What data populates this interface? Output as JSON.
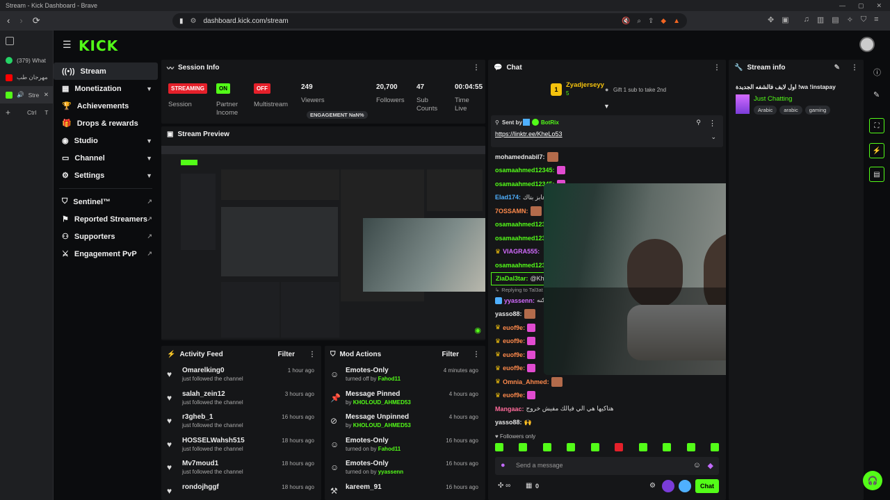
{
  "browser": {
    "title": "Stream - Kick Dashboard - Brave",
    "url": "dashboard.kick.com/stream",
    "tabs": [
      {
        "label": "(379) What"
      },
      {
        "label": "مهرجان طب"
      },
      {
        "label": "Stre"
      }
    ],
    "newtab_shortcut_ctrl": "Ctrl",
    "newtab_shortcut_key": "T"
  },
  "brand": {
    "logo": "KICK",
    "accent": "#53fc18"
  },
  "sidebar": {
    "items": [
      {
        "label": "Stream"
      },
      {
        "label": "Monetization"
      },
      {
        "label": "Achievements"
      },
      {
        "label": "Drops & rewards"
      },
      {
        "label": "Studio"
      },
      {
        "label": "Channel"
      },
      {
        "label": "Settings"
      }
    ],
    "extra": [
      {
        "label": "Sentinel™"
      },
      {
        "label": "Reported Streamers"
      },
      {
        "label": "Supporters"
      },
      {
        "label": "Engagement PvP"
      }
    ]
  },
  "session": {
    "title": "Session Info",
    "session_badge": "STREAMING",
    "session_label": "Session",
    "partner_badge": "ON",
    "partner_label1": "Partner",
    "partner_label2": "Income",
    "multi_badge": "OFF",
    "multi_label": "Multistream",
    "viewers": "249",
    "viewers_label": "Viewers",
    "engagement": "ENGAGEMENT NaN%",
    "followers": "20,700",
    "followers_label": "Followers",
    "subs": "47",
    "subs_label1": "Sub",
    "subs_label2": "Counts",
    "time": "00:04:55",
    "time_label1": "Time",
    "time_label2": "Live"
  },
  "preview": {
    "title": "Stream Preview"
  },
  "activity": {
    "title": "Activity Feed",
    "filter": "Filter",
    "rows": [
      {
        "name": "Omarelking0",
        "sub": "just followed the channel",
        "time": "1 hour ago"
      },
      {
        "name": "salah_zein12",
        "sub": "just followed the channel",
        "time": "3 hours ago"
      },
      {
        "name": "r3gheb_1",
        "sub": "just followed the channel",
        "time": "16 hours ago"
      },
      {
        "name": "HOSSELWahsh515",
        "sub": "just followed the channel",
        "time": "18 hours ago"
      },
      {
        "name": "Mv7moud1",
        "sub": "just followed the channel",
        "time": "18 hours ago"
      },
      {
        "name": "rondojhggf",
        "sub": "",
        "time": "18 hours ago"
      }
    ]
  },
  "mod": {
    "title": "Mod Actions",
    "filter": "Filter",
    "rows": [
      {
        "name": "Emotes-Only",
        "pre": "turned off by",
        "by": "Fahod11",
        "time": "4 minutes ago"
      },
      {
        "name": "Message Pinned",
        "pre": "by",
        "by": "KHOLOUD_AHMED53",
        "time": "4 hours ago"
      },
      {
        "name": "Message Unpinned",
        "pre": "by",
        "by": "KHOLOUD_AHMED53",
        "time": "4 hours ago"
      },
      {
        "name": "Emotes-Only",
        "pre": "turned on by",
        "by": "Fahod11",
        "time": "16 hours ago"
      },
      {
        "name": "Emotes-Only",
        "pre": "turned on by",
        "by": "yyassenn",
        "time": "16 hours ago"
      },
      {
        "name": "kareem_91",
        "pre": "",
        "by": "",
        "time": "16 hours ago"
      }
    ]
  },
  "chat": {
    "title": "Chat",
    "gifter": "Zyadjerseyy",
    "gifter_count": "5",
    "gift_text": "Gift 1 sub to take 2nd",
    "pinned_by_label": "Sent by",
    "pinned_by": "BotRix",
    "pinned_link": "https://linktr.ee/KheLo53",
    "lines": [
      {
        "user": "mohamednabil7:",
        "color": "#e6e6e6",
        "msg": ""
      },
      {
        "user": "osamaahmed12345:",
        "color": "#53fc18",
        "msg": ""
      },
      {
        "user": "osamaahmed12345:",
        "color": "#53fc18",
        "msg": ""
      },
      {
        "user": "Elad174:",
        "color": "#4fb0ff",
        "msg": "عد عابز بتاك"
      },
      {
        "user": "7OSSAMN:",
        "color": "#ff8a4c",
        "msg": ""
      },
      {
        "user": "osamaahmed1234",
        "color": "#53fc18",
        "msg": ""
      },
      {
        "user": "osamaahmed1234",
        "color": "#53fc18",
        "msg": ""
      },
      {
        "user": "VIAGRA555:",
        "color": "#d36bff",
        "msg": ""
      },
      {
        "user": "osamaahmed1234",
        "color": "#53fc18",
        "msg": ""
      }
    ],
    "reply_user": "ZiaDal3tar:",
    "reply_msg": "@Khek",
    "replying_label": "Replying to Tal3at",
    "reply_by": "yyassenn:",
    "reply_text": "ممكنه",
    "lines2": [
      {
        "user": "yasso88:",
        "color": "#e6e6e6",
        "msg": ""
      },
      {
        "user": "euof9e:",
        "color": "#ff8a4c",
        "msg": ""
      },
      {
        "user": "euof9e:",
        "color": "#ff8a4c",
        "msg": ""
      },
      {
        "user": "euof9e:",
        "color": "#ff8a4c",
        "msg": ""
      },
      {
        "user": "euof9e:",
        "color": "#ff8a4c",
        "msg": ""
      },
      {
        "user": "Omnia_Ahmed:",
        "color": "#ff8a4c",
        "msg": ""
      },
      {
        "user": "euof9e:",
        "color": "#ff8a4c",
        "msg": ""
      },
      {
        "user": "Mangaac:",
        "color": "#ff6b9a",
        "msg": "هتاكيها هي الي فيالك مفيش خروج"
      },
      {
        "user": "yasso88:",
        "color": "#e6e6e6",
        "msg": ""
      }
    ],
    "followers_only": "Followers only",
    "placeholder": "Send a message",
    "count_a": "0",
    "send": "Chat"
  },
  "streaminfo": {
    "title": "Stream info",
    "stream_title": "اول لايف فالشفه الجديدة !wa !instapay",
    "category": "Just Chatting",
    "tags": [
      "Arabic",
      "arabic",
      "gaming"
    ]
  }
}
